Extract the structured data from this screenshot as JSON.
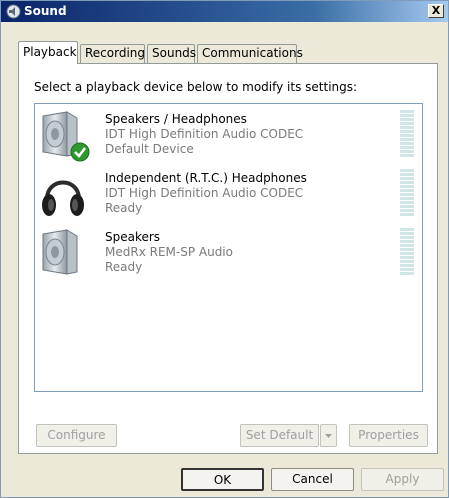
{
  "window": {
    "title": "Sound",
    "close_label": "X"
  },
  "tabs": [
    {
      "label": "Playback"
    },
    {
      "label": "Recording"
    },
    {
      "label": "Sounds"
    },
    {
      "label": "Communications"
    }
  ],
  "instruction": "Select a playback device below to modify its settings:",
  "devices": [
    {
      "name": "Speakers / Headphones",
      "description": "IDT High Definition Audio CODEC",
      "status": "Default Device",
      "icon": "speaker-icon",
      "default": true
    },
    {
      "name": "Independent (R.T.C.) Headphones",
      "description": "IDT High Definition Audio CODEC",
      "status": "Ready",
      "icon": "headphones-icon",
      "default": false
    },
    {
      "name": "Speakers",
      "description": "MedRx REM-SP Audio",
      "status": "Ready",
      "icon": "speaker-icon",
      "default": false
    }
  ],
  "panel_buttons": {
    "configure": "Configure",
    "set_default": "Set Default",
    "properties": "Properties"
  },
  "dialog_buttons": {
    "ok": "OK",
    "cancel": "Cancel",
    "apply": "Apply"
  },
  "colors": {
    "titlebar_start": "#0a246a",
    "meter_bar": "#cfe6e8",
    "default_check": "#2e9a2e"
  }
}
